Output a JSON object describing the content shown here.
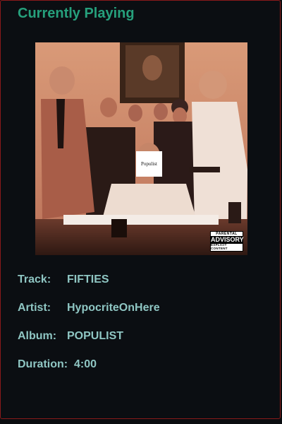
{
  "header": {
    "title": "Currently Playing"
  },
  "cover": {
    "sign_text": "Populist",
    "advisory": {
      "line1": "PARENTAL",
      "line2": "ADVISORY",
      "line3": "EXPLICIT CONTENT"
    }
  },
  "track": {
    "track_label": "Track:",
    "track_value": "FIFTIES",
    "artist_label": "Artist:",
    "artist_value": "HypocriteOnHere",
    "album_label": "Album:",
    "album_value": "POPULIST",
    "duration_label": "Duration:",
    "duration_value": "4:00"
  },
  "colors": {
    "accent": "#26a07c",
    "text": "#8fc6c3",
    "background": "#0b0e12",
    "border": "#8a1a1a"
  }
}
